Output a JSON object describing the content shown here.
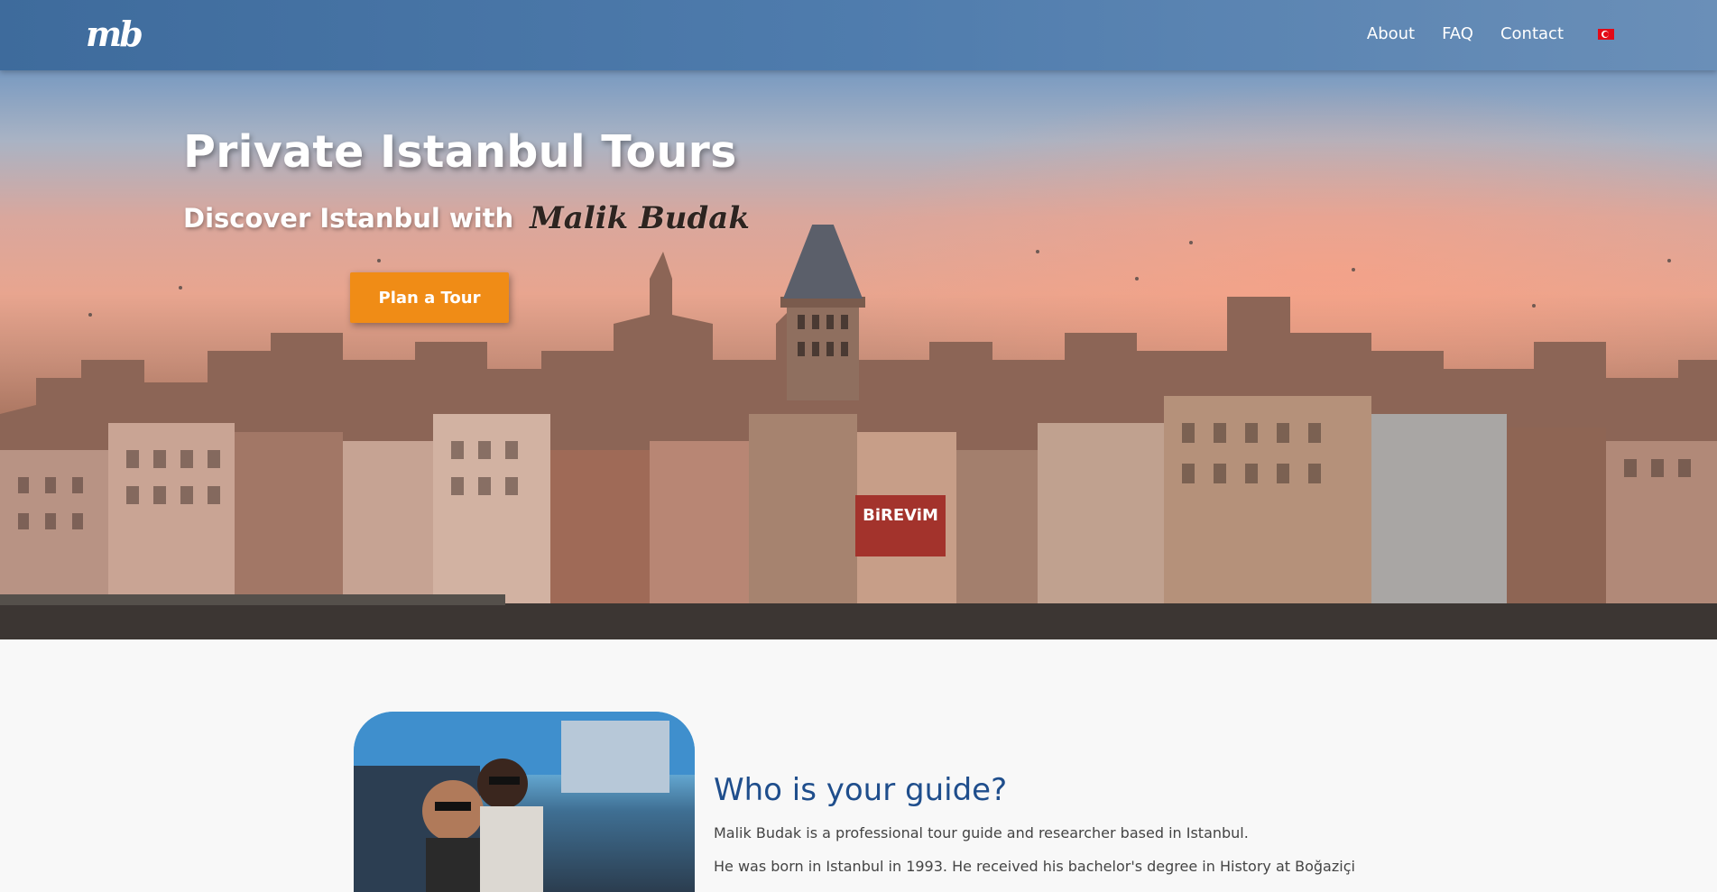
{
  "header": {
    "logo": "mb",
    "nav": [
      {
        "label": "About"
      },
      {
        "label": "FAQ"
      },
      {
        "label": "Contact"
      }
    ],
    "language_flag": "turkey-flag-icon"
  },
  "hero": {
    "title": "Private Istanbul Tours",
    "subtitle_prefix": "Discover Istanbul with",
    "signature": "Malik Budak",
    "cta_label": "Plan a Tour",
    "billboard": "BiREViM"
  },
  "about": {
    "title": "Who is your guide?",
    "paragraph1": "Malik Budak is a professional tour guide and researcher based in Istanbul.",
    "paragraph2": "He was born in Istanbul in 1993. He received his bachelor's degree in History at Boğaziçi"
  },
  "colors": {
    "accent": "#f08c16",
    "heading_blue": "#1f4e8c",
    "topbar": "#4f7cad"
  }
}
